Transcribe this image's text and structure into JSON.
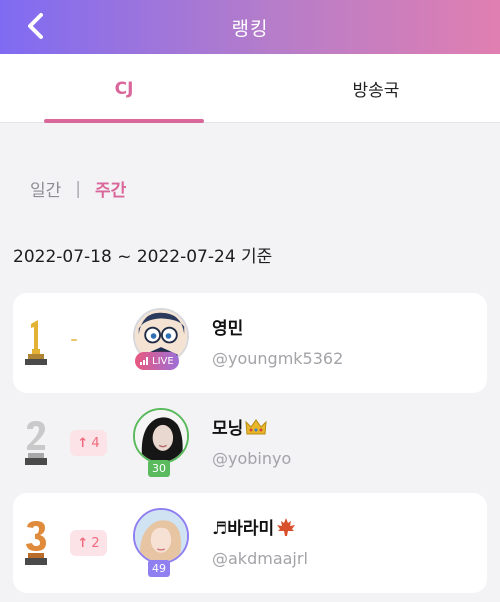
{
  "header": {
    "title": "랭킹"
  },
  "tabs": [
    {
      "label": "CJ"
    },
    {
      "label": "방송국"
    }
  ],
  "period": {
    "daily": "일간",
    "separator": "|",
    "weekly": "주간"
  },
  "date_range": "2022-07-18 ~ 2022-07-24 기준",
  "rankings": [
    {
      "rank": "1",
      "change": "-",
      "nickname": "영민",
      "handle": "@youngmk5362",
      "live_label": "LIVE"
    },
    {
      "rank": "2",
      "change": "4",
      "nickname": "모닝",
      "handle": "@yobinyo",
      "level": "30",
      "level_color": "#5aba5d"
    },
    {
      "rank": "3",
      "change": "2",
      "nickname": "♬바라미",
      "handle": "@akdmaajrl",
      "level": "49",
      "level_color": "#8f7ff0"
    }
  ],
  "colors": {
    "accent": "#d9679b",
    "gold": "#e3b134",
    "silver": "#b8b8b8",
    "bronze": "#e08a3c",
    "rank_up": "#ef6b7d"
  }
}
